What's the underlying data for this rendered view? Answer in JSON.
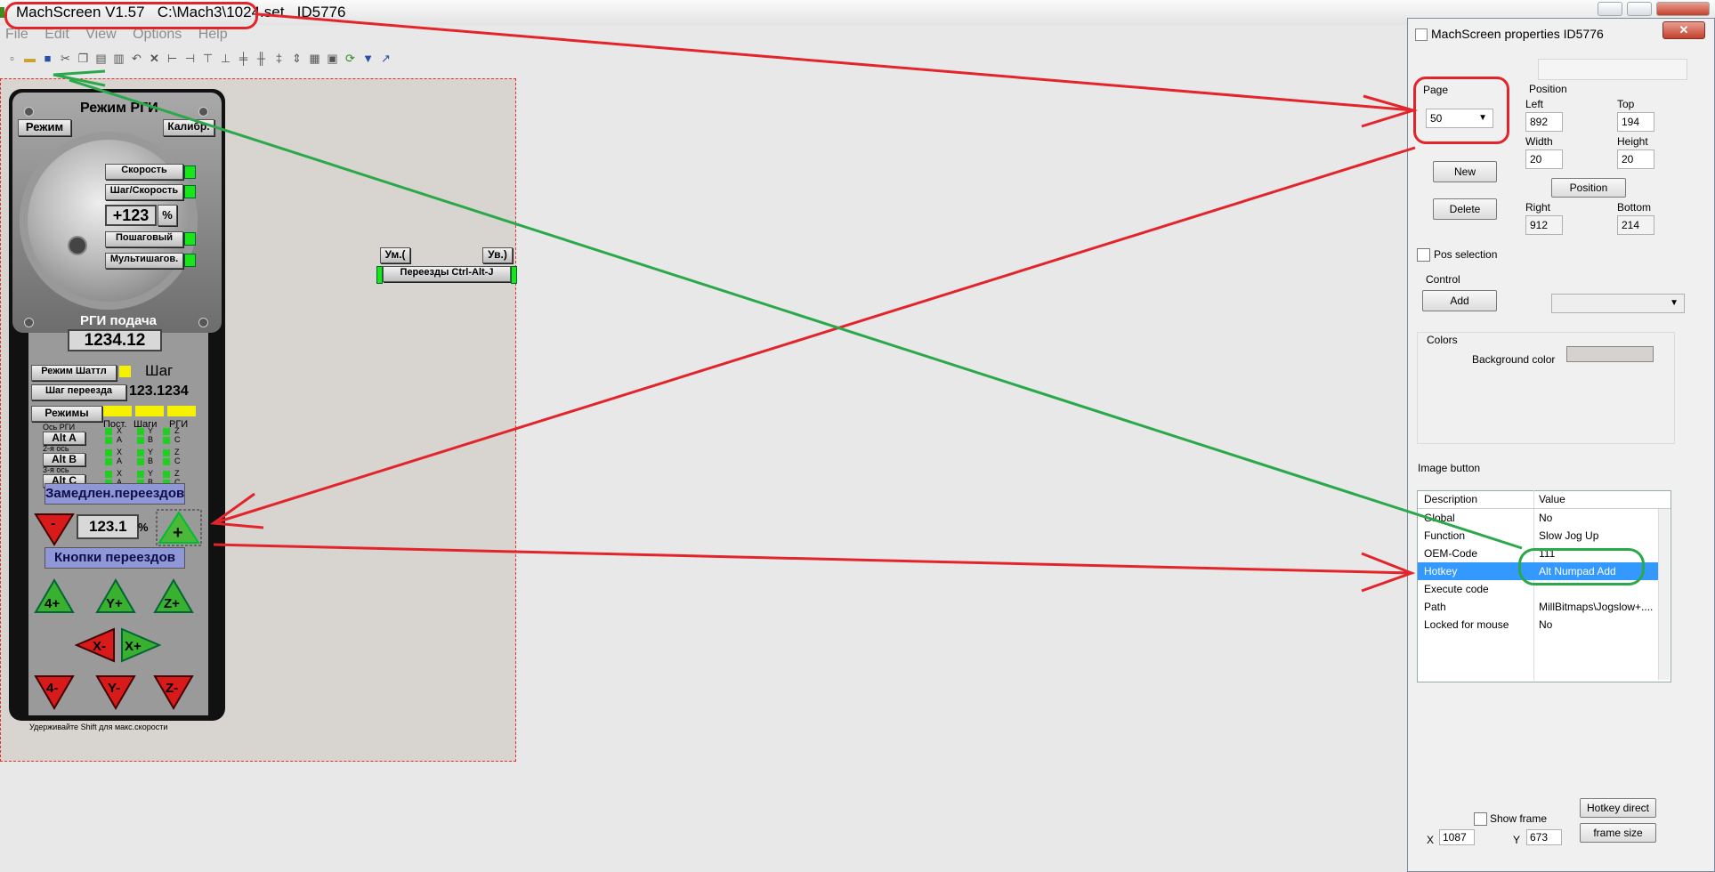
{
  "window": {
    "app_title": "MachScreen V1.57   C:\\Mach3\\1024.set   ID5776"
  },
  "menu": [
    "File",
    "Edit",
    "View",
    "Options",
    "Help"
  ],
  "toolbar_icons": [
    "new-icon",
    "open-icon",
    "save-icon",
    "cut-icon",
    "copy-icon",
    "paste-icon",
    "print-icon",
    "undo-icon",
    "delete-icon",
    "align-left-icon",
    "align-right-icon",
    "align-top-icon",
    "align-bottom-icon",
    "center-h-icon",
    "center-v-icon",
    "space-h-icon",
    "space-v-icon",
    "grid-icon",
    "snap-icon",
    "refresh-icon",
    "export-icon",
    "chart-icon"
  ],
  "pendant": {
    "title": "Режим РГИ",
    "mode_btn": "Режим",
    "calib_btn": "Калибр.",
    "speed_btn": "Скорость",
    "step_speed_btn": "Шаг/Скорость",
    "jog_value": "+123",
    "percent": "%",
    "stepwise_btn": "Пошаговый",
    "multistep_btn": "Мультишагов.",
    "feed_label": "РГИ подача",
    "feed_value": "1234.12",
    "shuttle_btn": "Режим Шаттл",
    "step_label": "Шаг",
    "move_step_btn": "Шаг переезда",
    "move_step_value": "123.1234",
    "modes_btn": "Режимы",
    "col_const": "Пост.",
    "col_steps": "Шаги",
    "col_rgi": "РГИ",
    "axis_label_1": "Ось РГИ",
    "axis_label_2": "2-я ось",
    "axis_label_3": "3-я ось",
    "alt_a": "Alt A",
    "alt_b": "Alt B",
    "alt_c": "Alt C",
    "pairs": [
      [
        "X",
        "A"
      ],
      [
        "Y",
        "B"
      ],
      [
        "Z",
        "C"
      ]
    ],
    "slow_moves": "Замедлен.переездов",
    "slow_value": "123.1",
    "minus": "-",
    "plus": "+",
    "jog_buttons": "Кнопки переездов",
    "jog": {
      "a_plus": "4+",
      "y_plus": "Y+",
      "z_plus": "Z+",
      "x_minus": "X-",
      "x_plus": "X+",
      "a_minus": "4-",
      "y_minus": "Y-",
      "z_minus": "Z-"
    },
    "hint": "Удерживайте Shift для макс.скорости"
  },
  "small_panel": {
    "dec": "Ум.(",
    "inc": "Ув.)",
    "moves": "Переезды Ctrl-Alt-J"
  },
  "props": {
    "title": "MachScreen properties  ID5776",
    "page_label": "Page",
    "page_value": "50",
    "position_label": "Position",
    "left_label": "Left",
    "left": "892",
    "top_label": "Top",
    "top": "194",
    "width_label": "Width",
    "width": "20",
    "height_label": "Height",
    "height": "20",
    "right_label": "Right",
    "right": "912",
    "bottom_label": "Bottom",
    "bottom": "214",
    "new_btn": "New",
    "delete_btn": "Delete",
    "position_btn": "Position",
    "pos_selection": "Pos selection",
    "control_label": "Control",
    "add_btn": "Add",
    "colors_label": "Colors",
    "bg_color_label": "Background color",
    "bg_color": "#d6d3ce",
    "image_button_label": "Image button",
    "grid_header": [
      "Description",
      "Value"
    ],
    "grid_rows": [
      [
        "Global",
        "No"
      ],
      [
        "Function",
        "Slow Jog Up"
      ],
      [
        "OEM-Code",
        "111"
      ],
      [
        "Hotkey",
        "Alt Numpad Add"
      ],
      [
        "Execute code",
        ""
      ],
      [
        "Path",
        "MillBitmaps\\Jogslow+...."
      ],
      [
        "Locked for mouse",
        "No"
      ]
    ],
    "show_frame": "Show frame",
    "hotkey_direct_btn": "Hotkey direct",
    "frame_size_btn": "frame size",
    "x_label": "X",
    "x_value": "1087",
    "y_label": "Y",
    "y_value": "673"
  },
  "colors": {
    "annotation_red": "#e3242b",
    "annotation_green": "#2aa84a",
    "selection": "#3399ff"
  }
}
